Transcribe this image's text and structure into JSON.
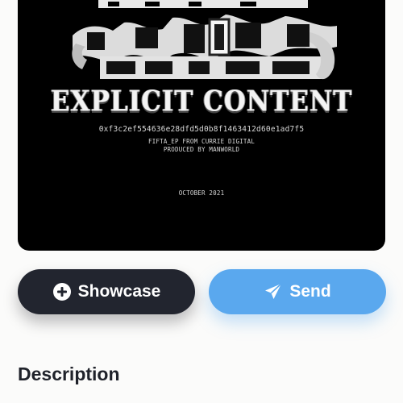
{
  "artwork": {
    "title": "EXPLICIT CONTENT",
    "hash": "0xf3c2ef554636e28dfd5d0b8f1463412d60e1ad7f5",
    "credit_line_1": "FIFTA_EP FROM CURRIE DIGITAL",
    "credit_line_2": "PRODUCED BY MANWORLD",
    "date": "OCTOBER 2021"
  },
  "actions": {
    "showcase_label": "Showcase",
    "send_label": "Send"
  },
  "description": {
    "heading": "Description"
  },
  "icons": {
    "showcase": "plus-circle-icon",
    "send": "paper-plane-icon"
  },
  "colors": {
    "showcase_button": "#22252f",
    "send_button": "#5aa8ee",
    "background": "#fbfbfa",
    "heading": "#1f222a"
  }
}
